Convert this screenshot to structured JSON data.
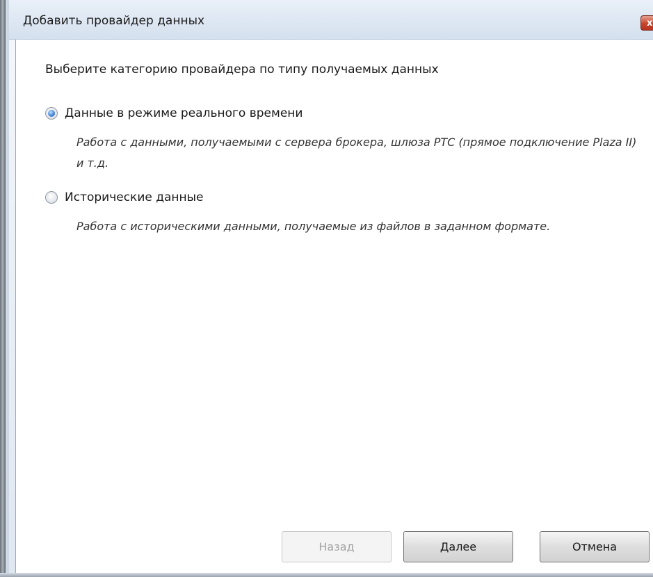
{
  "window": {
    "title": "Добавить провайдер данных",
    "close_glyph": "x"
  },
  "main": {
    "heading": "Выберите категорию провайдера по типу получаемых данных",
    "options": [
      {
        "label": "Данные в режиме реального времени",
        "description": "Работа с данными, получаемыми с сервера брокера, шлюза РТС (прямое подключение Plaza II)  и т.д.",
        "selected": true
      },
      {
        "label": "Исторические данные",
        "description": "Работа с историческими данными, получаемые из файлов в заданном формате.",
        "selected": false
      }
    ]
  },
  "footer": {
    "back_label": "Назад",
    "next_label": "Далее",
    "cancel_label": "Отмена"
  },
  "colors": {
    "radio_selected": "#3d7fd6",
    "close_button": "#c8442b",
    "disabled_text": "#a3a3a3"
  }
}
